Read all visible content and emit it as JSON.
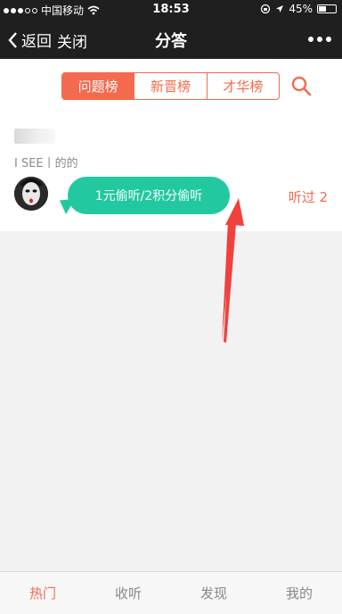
{
  "status_bar": {
    "carrier": "中国移动",
    "time": "18:53",
    "battery": "45%",
    "battery_level": 0.45,
    "signal_bars_filled": 3,
    "signal_bars_total": 5
  },
  "nav": {
    "back_label": "返回",
    "close_label": "关闭",
    "title": "分答"
  },
  "tabs": [
    {
      "label": "问题榜",
      "active": true
    },
    {
      "label": "新晋榜",
      "active": false
    },
    {
      "label": "才华榜",
      "active": false
    }
  ],
  "question": {
    "text": "I SEE丨的的",
    "bubble_label": "1元偷听/2积分偷听",
    "listen_count": "听过 2"
  },
  "bottom_tabs": [
    {
      "label": "热门",
      "active": true
    },
    {
      "label": "收听",
      "active": false
    },
    {
      "label": "发现",
      "active": false
    },
    {
      "label": "我的",
      "active": false
    }
  ],
  "colors": {
    "accent": "#f36a4e",
    "bubble": "#22c9a0",
    "annotation_arrow": "#f0413c"
  },
  "icons": {
    "back": "chevron-left-icon",
    "more": "more-dots-icon",
    "search": "search-icon",
    "wifi": "wifi-icon",
    "location": "location-arrow-icon",
    "lock": "orientation-lock-icon"
  }
}
